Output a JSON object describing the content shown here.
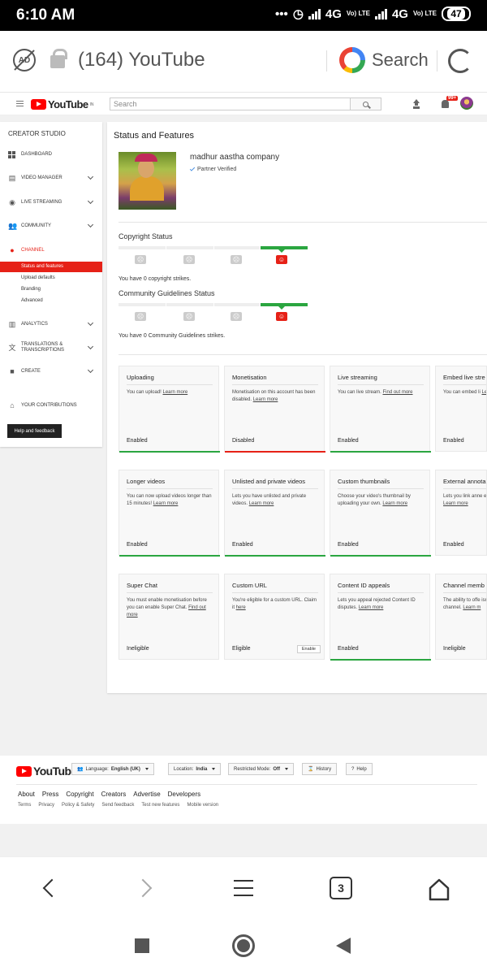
{
  "status_bar": {
    "time": "6:10 AM",
    "network1": "4G",
    "network2": "4G",
    "volte": "Vo) LTE",
    "battery": "47"
  },
  "browser": {
    "tab_title": "(164) YouTube",
    "search_label": "Search"
  },
  "yt_header": {
    "logo_text": "YouTube",
    "region": "IN",
    "search_placeholder": "Search",
    "notification_badge": "99+"
  },
  "sidebar": {
    "title": "CREATOR STUDIO",
    "items": [
      {
        "label": "DASHBOARD"
      },
      {
        "label": "VIDEO MANAGER"
      },
      {
        "label": "LIVE STREAMING"
      },
      {
        "label": "COMMUNITY"
      },
      {
        "label": "CHANNEL"
      },
      {
        "label": "ANALYTICS"
      },
      {
        "label": "TRANSLATIONS & TRANSCRIPTIONS"
      },
      {
        "label": "CREATE"
      },
      {
        "label": "YOUR CONTRIBUTIONS"
      }
    ],
    "channel_sub": [
      "Status and features",
      "Upload defaults",
      "Branding",
      "Advanced"
    ],
    "help_button": "Help and feedback"
  },
  "main": {
    "title": "Status and Features",
    "channel_name": "madhur aastha company",
    "partner_status": "Partner Verified",
    "copyright_title": "Copyright Status",
    "copyright_text": "You have 0 copyright strikes.",
    "community_title": "Community Guidelines Status",
    "community_text": "You have 0 Community Guidelines strikes.",
    "cards": [
      {
        "title": "Uploading",
        "desc": "You can upload! ",
        "link": "Learn more",
        "status": "Enabled",
        "bar": "#2ba640"
      },
      {
        "title": "Monetisation",
        "desc": "Monetisation on this account has been disabled. ",
        "link": "Learn more",
        "status": "Disabled",
        "bar": "#e62117"
      },
      {
        "title": "Live streaming",
        "desc": "You can live stream. ",
        "link": "Find out more",
        "status": "Enabled",
        "bar": "#2ba640"
      },
      {
        "title": "Embed live stre",
        "desc": "You can embed li ",
        "link": "Learn more",
        "status": "Enabled",
        "bar": "#2ba640"
      },
      {
        "title": "Longer videos",
        "desc": "You can now upload videos longer than 15 minutes! ",
        "link": "Learn more",
        "status": "Enabled",
        "bar": "#2ba640"
      },
      {
        "title": "Unlisted and private videos",
        "desc": "Lets you have unlisted and private videos. ",
        "link": "Learn more",
        "status": "Enabled",
        "bar": "#2ba640"
      },
      {
        "title": "Custom thumbnails",
        "desc": "Choose your video's thumbnail by uploading your own. ",
        "link": "Learn more",
        "status": "Enabled",
        "bar": "#2ba640"
      },
      {
        "title": "External annota",
        "desc": "Lets you link anne external sites or n ",
        "link": "Learn more",
        "status": "Enabled",
        "bar": "#2ba640"
      },
      {
        "title": "Super Chat",
        "desc": "You must enable monetisation before you can enable Super Chat. ",
        "link": "Find out more",
        "status": "Ineligible",
        "bar": ""
      },
      {
        "title": "Custom URL",
        "desc": "You're eligible for a custom URL. Claim it ",
        "link": "here",
        "status": "Eligible",
        "bar": "",
        "button": "Enable"
      },
      {
        "title": "Content ID appeals",
        "desc": "Lets you appeal rejected Content ID disputes. ",
        "link": "Learn more",
        "status": "Enabled",
        "bar": "#2ba640"
      },
      {
        "title": "Channel memb",
        "desc": "The ability to offe isn't yet available channel. ",
        "link": "Learn m",
        "status": "Ineligible",
        "bar": ""
      }
    ]
  },
  "footer": {
    "language_label": "Language:",
    "language_value": "English (UK)",
    "location_label": "Location:",
    "location_value": "India",
    "restricted_label": "Restricted Mode:",
    "restricted_value": "Off",
    "history": "History",
    "help": "Help",
    "links": [
      "About",
      "Press",
      "Copyright",
      "Creators",
      "Advertise",
      "Developers"
    ],
    "links2": [
      "Terms",
      "Privacy",
      "Policy & Safety",
      "Send feedback",
      "Test new features",
      "Mobile version"
    ]
  },
  "bottom_nav": {
    "tab_count": "3"
  }
}
